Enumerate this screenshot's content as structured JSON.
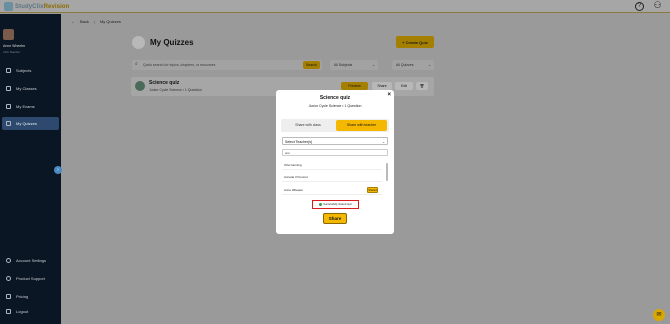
{
  "app": {
    "logo_text": "StudyClix",
    "logo_accent": "Revision"
  },
  "topbar": {
    "help_icon": "help-icon",
    "user_icon": "user-icon"
  },
  "sidebar": {
    "user_name": "Anne Wheeler",
    "user_role": "Irish Teacher",
    "items": [
      {
        "label": "Subjects",
        "icon": "book-icon"
      },
      {
        "label": "My Classes",
        "icon": "classes-icon"
      },
      {
        "label": "My Exams",
        "icon": "exams-icon"
      },
      {
        "label": "My Quizzes",
        "icon": "quiz-icon",
        "active": true
      },
      {
        "label": "Account Settings",
        "icon": "gear-icon"
      },
      {
        "label": "Product Support",
        "icon": "support-icon"
      },
      {
        "label": "Pricing",
        "icon": "pricing-icon"
      },
      {
        "label": "Logout",
        "icon": "logout-icon"
      }
    ]
  },
  "breadcrumb": {
    "back": "Back",
    "current": "My Quizzes"
  },
  "page": {
    "title": "My Quizzes",
    "create_label": "+ Create Quiz"
  },
  "filters": {
    "search_placeholder": "Quick search for topics, chapters, or resources",
    "search_button": "Search",
    "subjects": "All Subjects",
    "quizzes": "All Quizzes"
  },
  "quiz_card": {
    "title": "Science quiz",
    "subtitle": "Junior Cycle Science • 1 Question",
    "preview": "Preview",
    "share": "Share",
    "edit": "Edit"
  },
  "modal": {
    "title": "Science quiz",
    "subtitle": "Junior Cycle Science • 1 Question",
    "tabs": [
      "Share with class",
      "Share with teacher"
    ],
    "active_tab": 1,
    "select_label": "Select Teacher(s)",
    "search_value": "ann",
    "teachers": [
      {
        "name": "Orla Canning",
        "shared": false
      },
      {
        "name": "Annette O'Connor",
        "shared": false
      },
      {
        "name": "Anne Wheeler",
        "shared": true
      }
    ],
    "shared_label": "Shared",
    "toast": "Successfully shared quiz",
    "share_button": "Share"
  },
  "colors": {
    "accent": "#f5b800",
    "sidebar": "#0b1624",
    "toast_border": "#d91d1d"
  }
}
